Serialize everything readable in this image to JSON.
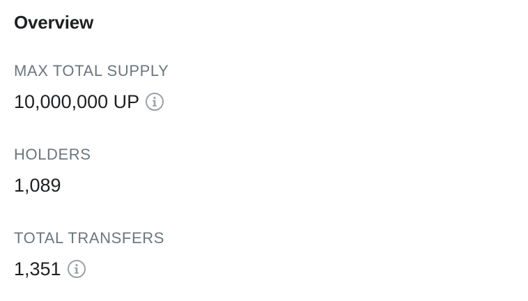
{
  "overview": {
    "title": "Overview",
    "stats": [
      {
        "label": "MAX TOTAL SUPPLY",
        "value": "10,000,000 UP",
        "has_info_icon": true,
        "icon": "info-icon"
      },
      {
        "label": "HOLDERS",
        "value": "1,089",
        "has_info_icon": false
      },
      {
        "label": "TOTAL TRANSFERS",
        "value": "1,351",
        "has_info_icon": true,
        "icon": "info-icon"
      }
    ]
  },
  "colors": {
    "text_primary": "#1e2022",
    "text_muted": "#6c757e",
    "icon_gray": "#9aa0a6",
    "background": "#ffffff"
  }
}
